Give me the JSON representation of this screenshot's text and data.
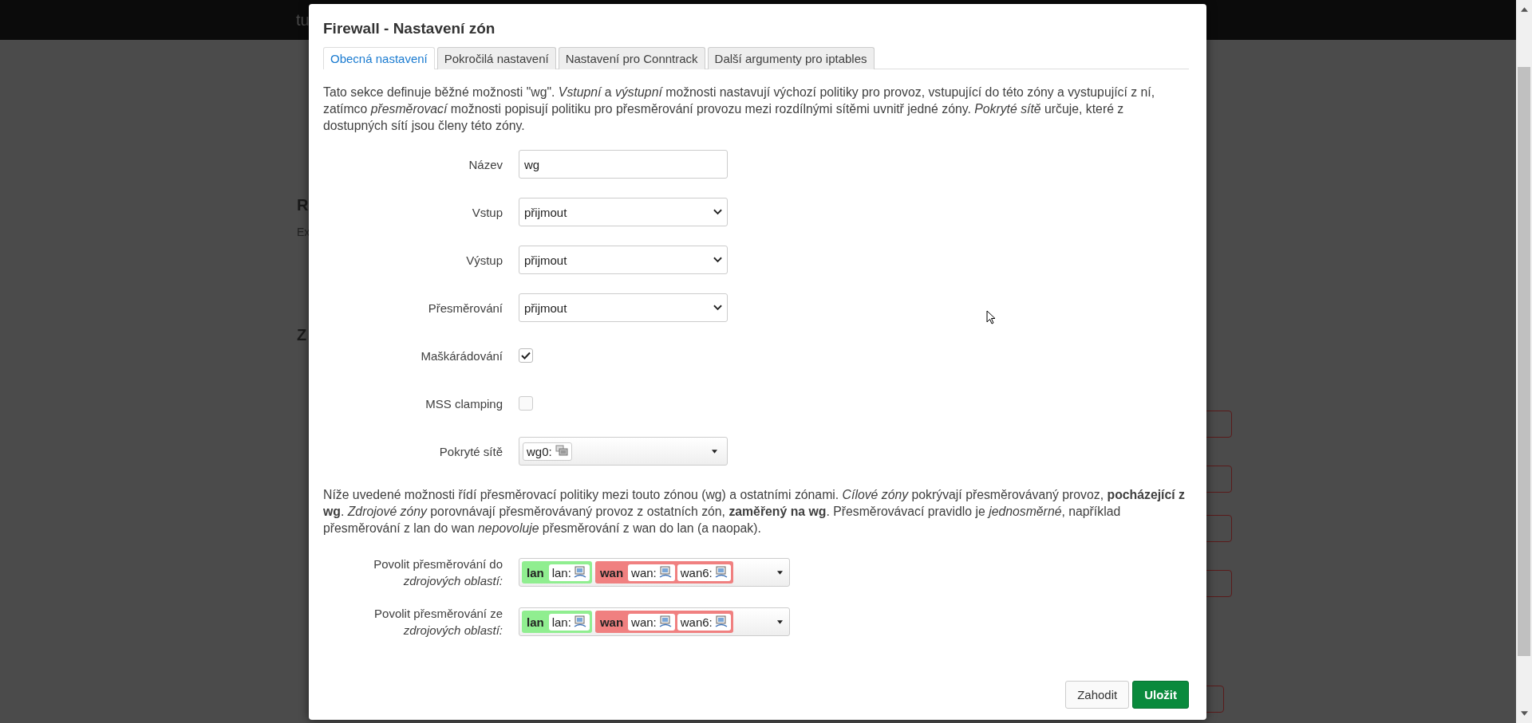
{
  "background": {
    "header_text": "tu",
    "texts": [
      "R",
      "Ex",
      "Z"
    ]
  },
  "dialog": {
    "title": "Firewall - Nastavení zón",
    "tabs": [
      {
        "label": "Obecná nastavení",
        "selected": true
      },
      {
        "label": "Pokročilá nastavení",
        "selected": false
      },
      {
        "label": "Nastavení pro Conntrack",
        "selected": false
      },
      {
        "label": "Další argumenty pro iptables",
        "selected": false
      }
    ],
    "description": "Tato sekce definuje běžné možnosti \"wg\". *Vstupní* a *výstupní* možnosti nastavují výchozí politiky pro provoz, vstupující do této zóny a vystupující z ní, zatímco *přesměrovací* možnosti popisují politiku pro přesměrování provozu mezi rozdílnými sítěmi uvnitř jedné zóny. *Pokryté sítě* určuje, které z dostupných sítí jsou členy této zóny.",
    "fields": [
      {
        "kind": "text",
        "label": "Název",
        "value": "wg"
      },
      {
        "kind": "select",
        "label": "Vstup",
        "value": "přijmout"
      },
      {
        "kind": "select",
        "label": "Výstup",
        "value": "přijmout"
      },
      {
        "kind": "select",
        "label": "Přesměrování",
        "value": "přijmout"
      },
      {
        "kind": "checkbox",
        "label": "Maškárádování",
        "checked": true
      },
      {
        "kind": "checkbox",
        "label": "MSS clamping",
        "checked": false
      },
      {
        "kind": "multiselect",
        "label": "Pokryté sítě",
        "items": [
          "wg0:"
        ]
      }
    ],
    "note": "Níže uvedené možnosti řídí přesměrovací politiky mezi touto zónou (wg) a ostatními zónami. *Cílové zóny* pokrývají přesměrovávaný provoz, **pocházející z wg**. *Zdrojové zóny* porovnávají přesměrovávaný provoz z ostatních zón, **zaměřený na wg**. Přesměrovávací pravidlo je *jednosměrné*, například přesměrování z lan do wan *nepovoluje* přesměrování z wan do lan (a naopak).",
    "forwardings": [
      {
        "label": "Povolit přesměrování do",
        "label_note": "zdrojových oblastí:",
        "zones": [
          {
            "name": "lan",
            "color": "#90ee90",
            "networks": [
              "lan:"
            ]
          },
          {
            "name": "wan",
            "color": "#f08080",
            "networks": [
              "wan:",
              "wan6:"
            ]
          }
        ]
      },
      {
        "label": "Povolit přesměrování ze",
        "label_note": "zdrojových oblastí:",
        "zones": [
          {
            "name": "lan",
            "color": "#90ee90",
            "networks": [
              "lan:"
            ]
          },
          {
            "name": "wan",
            "color": "#f08080",
            "networks": [
              "wan:",
              "wan6:"
            ]
          }
        ]
      }
    ],
    "buttons": [
      {
        "label": "Zahodit",
        "kind": "secondary"
      },
      {
        "label": "Uložit",
        "kind": "primary"
      }
    ]
  }
}
